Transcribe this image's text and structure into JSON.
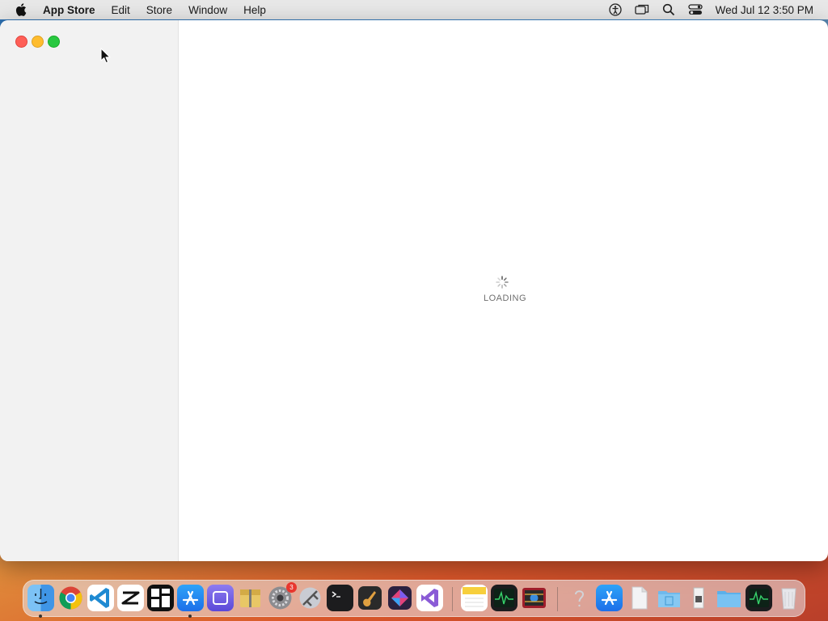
{
  "menubar": {
    "app_name": "App Store",
    "menus": [
      "Edit",
      "Store",
      "Window",
      "Help"
    ],
    "clock": "Wed Jul 12  3:50 PM",
    "status_icons": [
      "accessibility-icon",
      "screen-mirroring-icon",
      "spotlight-search-icon",
      "control-center-icon"
    ]
  },
  "window": {
    "loading_text": "LOADING"
  },
  "dock": {
    "items": [
      {
        "name": "finder",
        "running": true
      },
      {
        "name": "chrome",
        "running": false
      },
      {
        "name": "vscode",
        "running": false
      },
      {
        "name": "capcut",
        "running": false
      },
      {
        "name": "mosaic",
        "running": false
      },
      {
        "name": "app-store",
        "running": true
      },
      {
        "name": "rectangle",
        "running": false
      },
      {
        "name": "archive-utility",
        "running": false
      },
      {
        "name": "system-settings",
        "running": false,
        "badge": "3"
      },
      {
        "name": "directory-utility",
        "running": false
      },
      {
        "name": "terminal",
        "running": false
      },
      {
        "name": "garageband",
        "running": false
      },
      {
        "name": "affinity",
        "running": false
      },
      {
        "name": "visual-studio",
        "running": false
      },
      {
        "name": "notes",
        "running": false
      },
      {
        "name": "activity-monitor",
        "running": false
      },
      {
        "name": "photo-booth",
        "running": false
      },
      {
        "name": "help",
        "running": false
      },
      {
        "name": "app-store-2",
        "running": false
      },
      {
        "name": "document",
        "running": false
      },
      {
        "name": "folder-app",
        "running": false
      },
      {
        "name": "preview-file",
        "running": false
      },
      {
        "name": "downloads-folder",
        "running": false
      },
      {
        "name": "activity-monitor-2",
        "running": false
      },
      {
        "name": "trash",
        "running": false
      }
    ]
  },
  "colors": {
    "close": "#fe5f57",
    "minimize": "#febc2e",
    "maximize": "#28c840",
    "sidebar": "#f2f2f2",
    "badge": "#e8362e"
  }
}
